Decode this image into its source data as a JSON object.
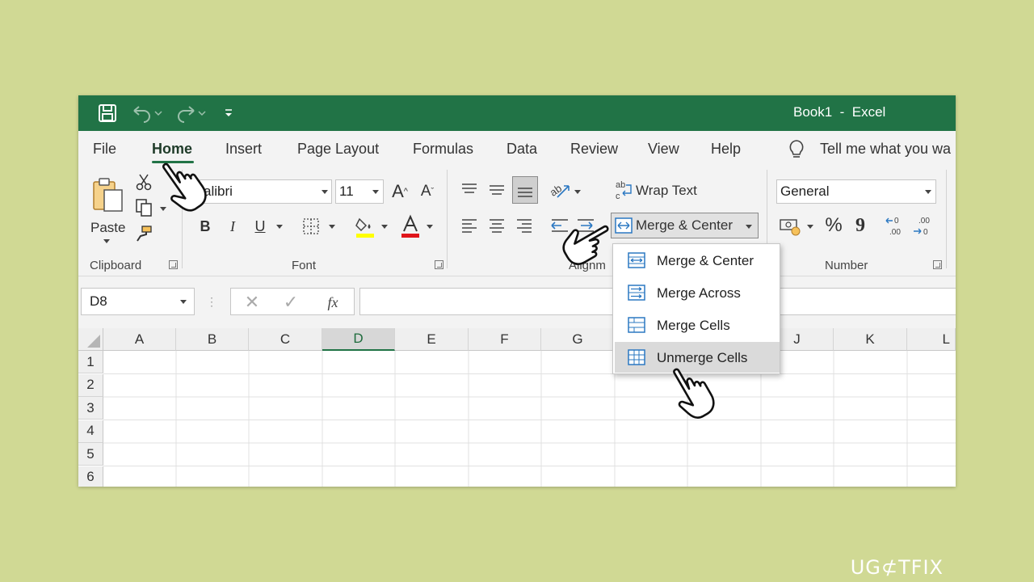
{
  "window": {
    "title": "Book1  -  Excel"
  },
  "tabs": [
    {
      "label": "File"
    },
    {
      "label": "Home"
    },
    {
      "label": "Insert"
    },
    {
      "label": "Page Layout"
    },
    {
      "label": "Formulas"
    },
    {
      "label": "Data"
    },
    {
      "label": "Review"
    },
    {
      "label": "View"
    },
    {
      "label": "Help"
    }
  ],
  "tell_me": {
    "label": "Tell me what you wa"
  },
  "ribbon": {
    "clipboard": {
      "paste_label": "Paste",
      "group_label": "Clipboard"
    },
    "font": {
      "font_name": "alibri",
      "font_size": "11",
      "group_label": "Font",
      "bold": "B",
      "italic": "I",
      "underline": "U"
    },
    "alignment": {
      "wrap_text_label": "Wrap Text",
      "merge_center_label": "Merge & Center",
      "group_label": "Alignm"
    },
    "number": {
      "format_value": "General",
      "group_label": "Number",
      "percent": "%",
      "comma": "9"
    }
  },
  "formula_bar": {
    "name_box_value": "D8",
    "fx_label": "fx",
    "formula_value": ""
  },
  "grid": {
    "columns": [
      "A",
      "B",
      "C",
      "D",
      "E",
      "F",
      "G",
      "",
      "",
      "J",
      "K",
      "L"
    ],
    "rows": [
      "1",
      "2",
      "3",
      "4",
      "5",
      "6"
    ],
    "selected_column": "D"
  },
  "merge_menu": {
    "items": [
      {
        "label": "Merge & Center"
      },
      {
        "label": "Merge Across"
      },
      {
        "label": "Merge Cells"
      },
      {
        "label": "Unmerge Cells"
      }
    ],
    "highlighted": "Unmerge Cells"
  },
  "watermark": {
    "text": "UG⊄TFIX"
  },
  "colors": {
    "excel_green": "#217346",
    "background": "#d0d994",
    "accent_blue": "#2b78c2"
  }
}
